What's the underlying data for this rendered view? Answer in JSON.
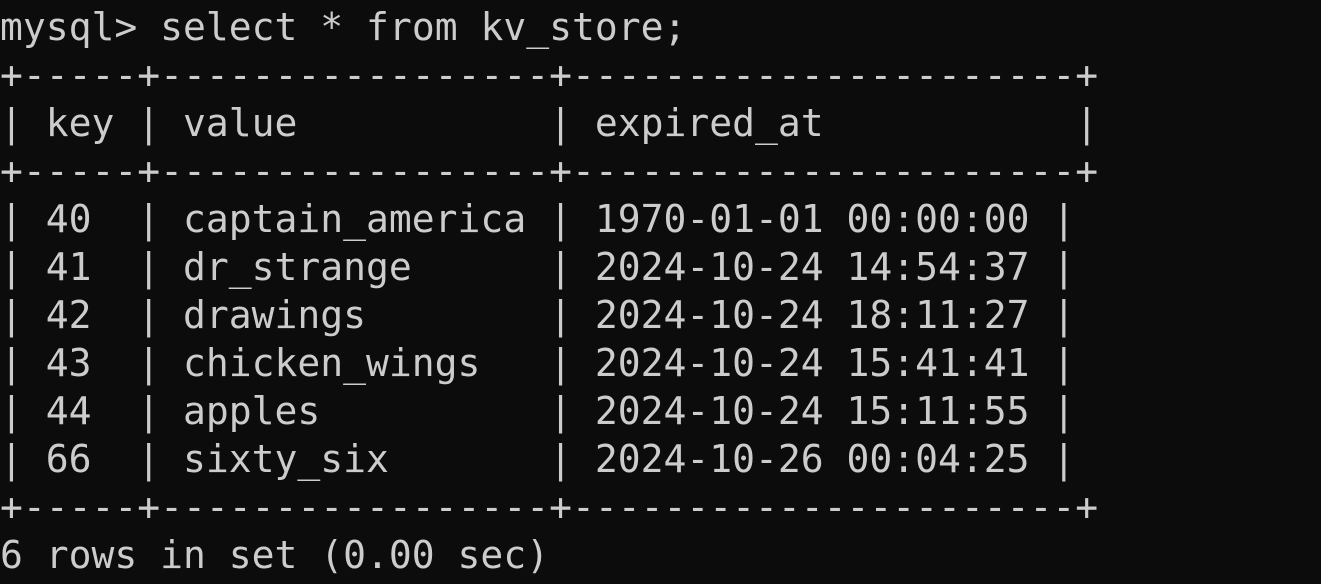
{
  "terminal": {
    "prompt": "mysql> ",
    "command": "select * from kv_store;",
    "lines": [
      "+-----+-----------------+----------------------+",
      "| key | value           | expired_at           |",
      "+-----+-----------------+----------------------+",
      "| 40  | captain_america | 1970-01-01 00:00:00 |",
      "| 41  | dr_strange      | 2024-10-24 14:54:37 |",
      "| 42  | drawings        | 2024-10-24 18:11:27 |",
      "| 43  | chicken_wings   | 2024-10-24 15:41:41 |",
      "| 44  | apples          | 2024-10-24 15:11:55 |",
      "| 66  | sixty_six       | 2024-10-26 00:04:25 |",
      "+-----+-----------------+----------------------+",
      "6 rows in set (0.00 sec)"
    ]
  },
  "colors": {
    "background": "#0c0c0c",
    "foreground": "#cccccc"
  }
}
